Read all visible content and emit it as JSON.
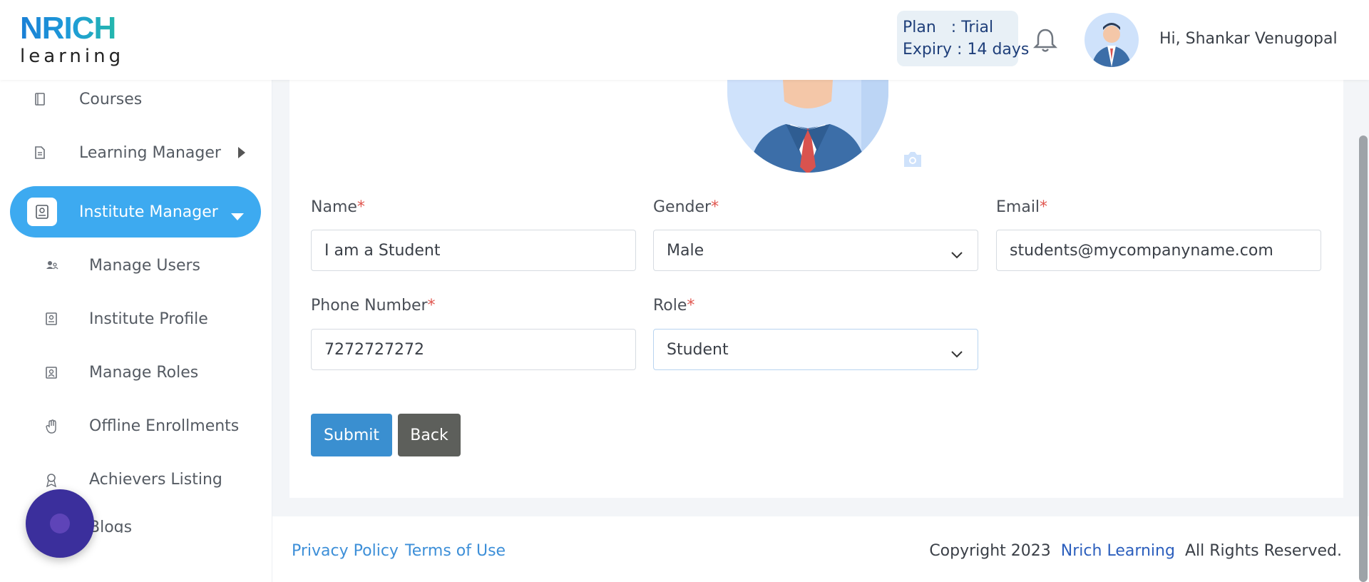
{
  "header": {
    "logo": {
      "top": "NRICH",
      "bottom": "learning"
    },
    "plan": {
      "line1": "Plan   : Trial",
      "line2": "Expiry : 14 days"
    },
    "greeting": "Hi, Shankar Venugopal"
  },
  "sidebar": {
    "items": [
      {
        "label": "Courses",
        "icon": "book-icon"
      },
      {
        "label": "Learning Manager",
        "icon": "document-icon"
      },
      {
        "label": "Institute Manager",
        "icon": "id-badge-icon"
      },
      {
        "label": "Manage Users",
        "icon": "users-icon"
      },
      {
        "label": "Institute Profile",
        "icon": "profile-card-icon"
      },
      {
        "label": "Manage Roles",
        "icon": "role-badge-icon"
      },
      {
        "label": "Offline Enrollments",
        "icon": "hand-icon"
      },
      {
        "label": "Achievers Listing",
        "icon": "award-icon"
      },
      {
        "label": "Blogs",
        "icon": "blog-icon"
      }
    ]
  },
  "form": {
    "name": {
      "label": "Name",
      "value": "I am a Student"
    },
    "gender": {
      "label": "Gender",
      "value": "Male"
    },
    "email": {
      "label": "Email",
      "value": "students@mycompanyname.com"
    },
    "phone": {
      "label": "Phone Number",
      "value": "7272727272"
    },
    "role": {
      "label": "Role",
      "value": "Student"
    },
    "required_mark": "*",
    "submit_label": "Submit",
    "back_label": "Back"
  },
  "footer": {
    "privacy": "Privacy Policy",
    "terms": "Terms of Use",
    "copyright_prefix": "Copyright 2023",
    "brand": "Nrich Learning",
    "copyright_suffix": "All Rights Reserved."
  },
  "colors": {
    "accent": "#3daaf0",
    "submit": "#3a8fd0",
    "back": "#5d5f5b",
    "required": "#e0564f",
    "link": "#3d8fd8"
  }
}
